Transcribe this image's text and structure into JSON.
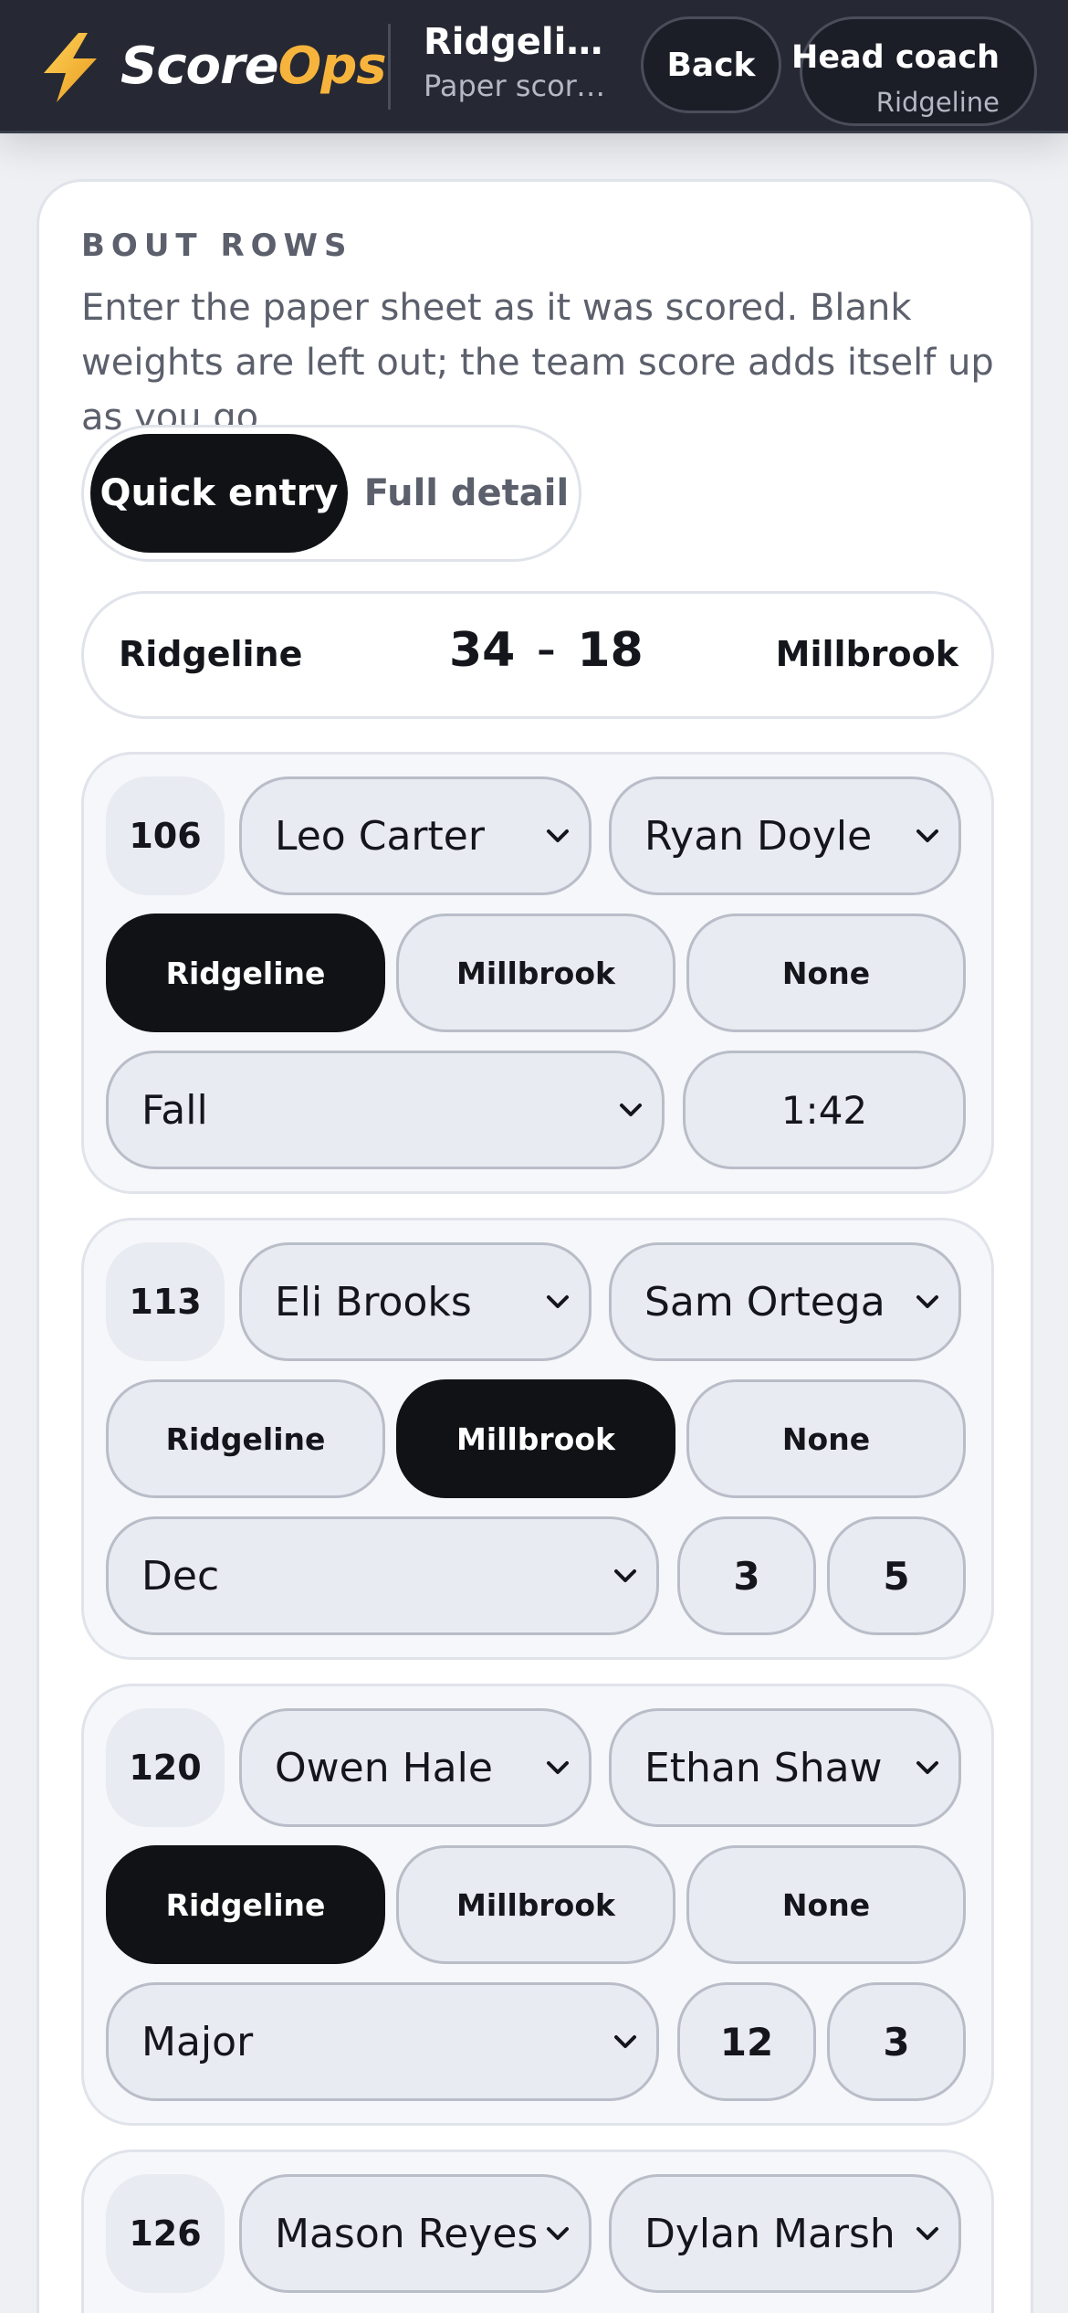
{
  "header": {
    "brand_part1": "Score",
    "brand_part2": "Ops",
    "brand_icon": "lightning-bolt-icon",
    "context_title": "Ridgeline vs Millbrook",
    "context_subtitle": "Paper score entry",
    "back_label": "Back",
    "user_role": "Head coach",
    "user_team": "Ridgeline"
  },
  "section": {
    "label": "BOUT ROWS",
    "description": "Enter the paper sheet as it was scored. Blank weights are left out; the team score adds itself up as you go."
  },
  "mode_toggle": {
    "active": "Quick entry",
    "inactive": "Full detail"
  },
  "scoreboard": {
    "home_team": "Ridgeline",
    "home_score": "34",
    "separator": "–",
    "away_score": "18",
    "away_team": "Millbrook"
  },
  "bouts": [
    {
      "weight": "106",
      "home_wrestler": "Leo Carter",
      "away_wrestler": "Ryan Doyle",
      "winner_options": [
        "Ridgeline",
        "Millbrook",
        "None"
      ],
      "winner": "Ridgeline",
      "result": "Fall",
      "time": "1:42"
    },
    {
      "weight": "113",
      "home_wrestler": "Eli Brooks",
      "away_wrestler": "Sam Ortega",
      "winner_options": [
        "Ridgeline",
        "Millbrook",
        "None"
      ],
      "winner": "Millbrook",
      "result": "Dec",
      "score_home": "3",
      "score_away": "5"
    },
    {
      "weight": "120",
      "home_wrestler": "Owen Hale",
      "away_wrestler": "Ethan Shaw",
      "winner_options": [
        "Ridgeline",
        "Millbrook",
        "None"
      ],
      "winner": "Ridgeline",
      "result": "Major",
      "score_home": "12",
      "score_away": "3"
    },
    {
      "weight": "126",
      "home_wrestler": "Mason Reyes",
      "away_wrestler": "Dylan Marsh"
    }
  ]
}
